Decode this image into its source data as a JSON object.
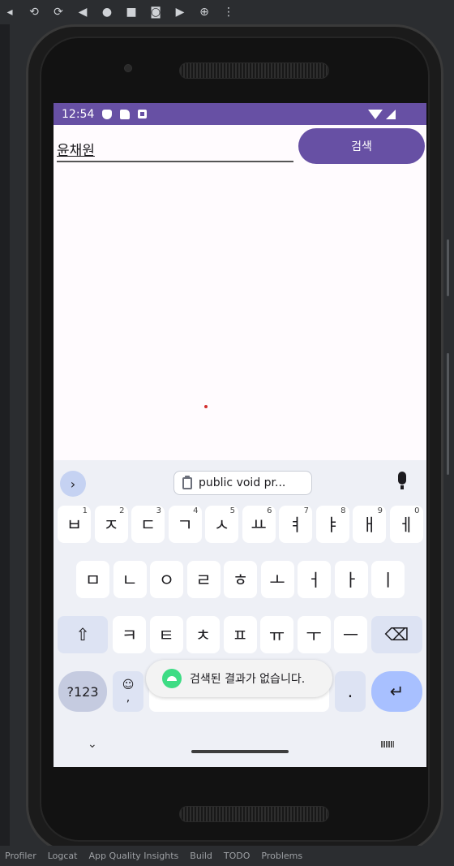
{
  "ide": {
    "bottom_items": [
      "Profiler",
      "Logcat",
      "App Quality Insights",
      "Build",
      "TODO",
      "Problems"
    ]
  },
  "status_bar": {
    "time": "12:54"
  },
  "search": {
    "value": "윤채원",
    "button_label": "검색"
  },
  "toast": {
    "message": "검색된 결과가 없습니다."
  },
  "keyboard": {
    "clipboard_text": "public void pr...",
    "row1": [
      {
        "k": "ㅂ",
        "n": "1"
      },
      {
        "k": "ㅈ",
        "n": "2"
      },
      {
        "k": "ㄷ",
        "n": "3"
      },
      {
        "k": "ㄱ",
        "n": "4"
      },
      {
        "k": "ㅅ",
        "n": "5"
      },
      {
        "k": "ㅛ",
        "n": "6"
      },
      {
        "k": "ㅕ",
        "n": "7"
      },
      {
        "k": "ㅑ",
        "n": "8"
      },
      {
        "k": "ㅐ",
        "n": "9"
      },
      {
        "k": "ㅔ",
        "n": "0"
      }
    ],
    "row2": [
      "ㅁ",
      "ㄴ",
      "ㅇ",
      "ㄹ",
      "ㅎ",
      "ㅗ",
      "ㅓ",
      "ㅏ",
      "ㅣ"
    ],
    "row3": [
      "ㅋ",
      "ㅌ",
      "ㅊ",
      "ㅍ",
      "ㅠ",
      "ㅜ",
      "ㅡ"
    ],
    "numbers_key": "?123",
    "emoji_key": "☺",
    "comma_key": ",",
    "period_key": "."
  }
}
